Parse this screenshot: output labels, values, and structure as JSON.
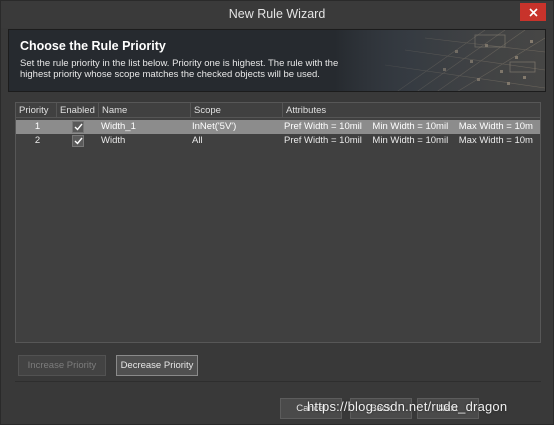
{
  "window": {
    "title": "New Rule Wizard"
  },
  "banner": {
    "title": "Choose the Rule Priority",
    "description": "Set the rule priority in the list below. Priority one is highest. The rule with the highest priority whose scope matches the checked objects will be used."
  },
  "table": {
    "headers": {
      "priority": "Priority",
      "enabled": "Enabled",
      "name": "Name",
      "scope": "Scope",
      "attributes": "Attributes"
    },
    "rows": [
      {
        "priority": "1",
        "enabled": true,
        "name": "Width_1",
        "scope": "InNet('5V')",
        "attributes": "Pref Width = 10mil    Min Width = 10mil    Max Width = 10m",
        "selected": true
      },
      {
        "priority": "2",
        "enabled": true,
        "name": "Width",
        "scope": "All",
        "attributes": "Pref Width = 10mil    Min Width = 10mil    Max Width = 10m",
        "selected": false
      }
    ]
  },
  "buttons": {
    "increase_priority": "Increase Priority",
    "decrease_priority": "Decrease Priority",
    "cancel": "Cancel",
    "back": "Back",
    "next": "Next"
  },
  "watermark": "https://blog.csdn.net/rude_dragon",
  "colors": {
    "close_button": "#c8332b",
    "selected_row": "#8c8c8c"
  }
}
